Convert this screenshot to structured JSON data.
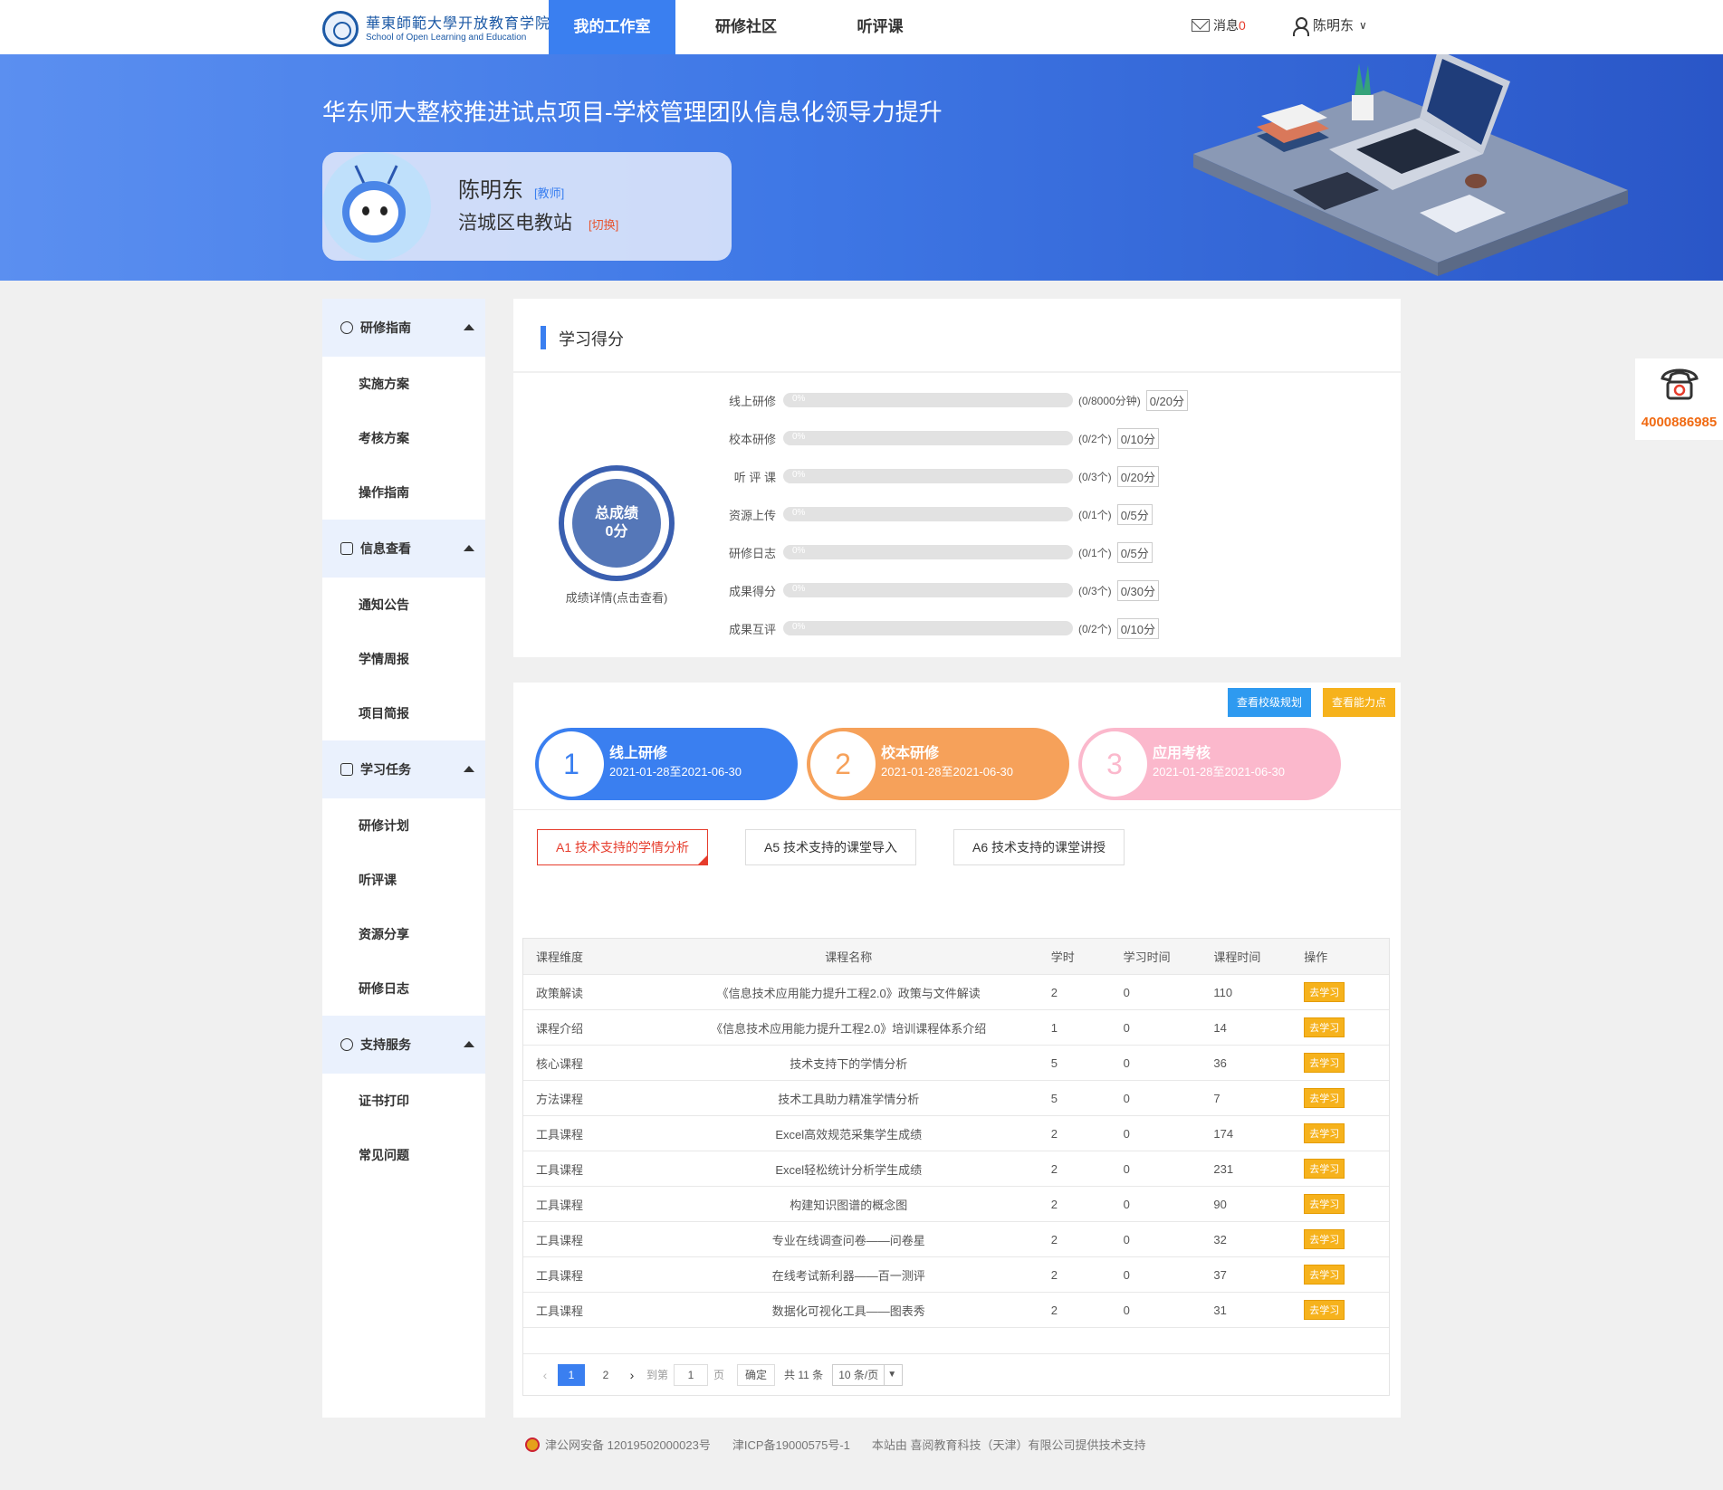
{
  "header": {
    "logo_cn": "華東師範大學开放教育学院",
    "logo_en": "School of Open Learning and Education",
    "nav": [
      {
        "label": "我的工作室",
        "active": true
      },
      {
        "label": "研修社区",
        "active": false
      },
      {
        "label": "听评课",
        "active": false
      }
    ],
    "messages_label": "消息",
    "messages_count": "0",
    "user_name": "陈明东"
  },
  "banner": {
    "title": "华东师大整校推进试点项目-学校管理团队信息化领导力提升",
    "name": "陈明东",
    "role_tag": "[教师]",
    "org": "涪城区电教站",
    "switch_label": "[切换]"
  },
  "sidebar": {
    "groups": [
      {
        "label": "研修指南",
        "items": [
          "实施方案",
          "考核方案",
          "操作指南"
        ]
      },
      {
        "label": "信息查看",
        "items": [
          "通知公告",
          "学情周报",
          "项目简报"
        ]
      },
      {
        "label": "学习任务",
        "items": [
          "研修计划",
          "听评课",
          "资源分享",
          "研修日志"
        ]
      },
      {
        "label": "支持服务",
        "items": [
          "证书打印",
          "常见问题"
        ]
      }
    ]
  },
  "score": {
    "section_title": "学习得分",
    "total_label": "总成绩",
    "total_value": "0分",
    "detail_link": "成绩详情(点击查看)",
    "rows": [
      {
        "label": "线上研修",
        "percent": "0%",
        "count": "(0/8000分钟)",
        "points": "0/20分"
      },
      {
        "label": "校本研修",
        "percent": "0%",
        "count": "(0/2个)",
        "points": "0/10分"
      },
      {
        "label": "听 评 课",
        "percent": "0%",
        "count": "(0/3个)",
        "points": "0/20分"
      },
      {
        "label": "资源上传",
        "percent": "0%",
        "count": "(0/1个)",
        "points": "0/5分"
      },
      {
        "label": "研修日志",
        "percent": "0%",
        "count": "(0/1个)",
        "points": "0/5分"
      },
      {
        "label": "成果得分",
        "percent": "0%",
        "count": "(0/3个)",
        "points": "0/30分"
      },
      {
        "label": "成果互评",
        "percent": "0%",
        "count": "(0/2个)",
        "points": "0/10分"
      }
    ]
  },
  "stages": {
    "btn_plan": "查看校级规划",
    "btn_ability": "查看能力点",
    "items": [
      {
        "num": "1",
        "title": "线上研修",
        "dates": "2021-01-28至2021-06-30"
      },
      {
        "num": "2",
        "title": "校本研修",
        "dates": "2021-01-28至2021-06-30"
      },
      {
        "num": "3",
        "title": "应用考核",
        "dates": "2021-01-28至2021-06-30"
      }
    ],
    "abilities": [
      {
        "label": "A1 技术支持的学情分析",
        "active": true
      },
      {
        "label": "A5 技术支持的课堂导入",
        "active": false
      },
      {
        "label": "A6 技术支持的课堂讲授",
        "active": false
      }
    ]
  },
  "table": {
    "headers": [
      "课程维度",
      "课程名称",
      "学时",
      "学习时间",
      "课程时间",
      "操作"
    ],
    "action_label": "去学习",
    "rows": [
      {
        "dim": "政策解读",
        "name": "《信息技术应用能力提升工程2.0》政策与文件解读",
        "hours": "2",
        "study": "0",
        "course": "110"
      },
      {
        "dim": "课程介绍",
        "name": "《信息技术应用能力提升工程2.0》培训课程体系介绍",
        "hours": "1",
        "study": "0",
        "course": "14"
      },
      {
        "dim": "核心课程",
        "name": "技术支持下的学情分析",
        "hours": "5",
        "study": "0",
        "course": "36"
      },
      {
        "dim": "方法课程",
        "name": "技术工具助力精准学情分析",
        "hours": "5",
        "study": "0",
        "course": "7"
      },
      {
        "dim": "工具课程",
        "name": "Excel高效规范采集学生成绩",
        "hours": "2",
        "study": "0",
        "course": "174"
      },
      {
        "dim": "工具课程",
        "name": "Excel轻松统计分析学生成绩",
        "hours": "2",
        "study": "0",
        "course": "231"
      },
      {
        "dim": "工具课程",
        "name": "构建知识图谱的概念图",
        "hours": "2",
        "study": "0",
        "course": "90"
      },
      {
        "dim": "工具课程",
        "name": "专业在线调查问卷——问卷星",
        "hours": "2",
        "study": "0",
        "course": "32"
      },
      {
        "dim": "工具课程",
        "name": "在线考试新利器——百一测评",
        "hours": "2",
        "study": "0",
        "course": "37"
      },
      {
        "dim": "工具课程",
        "name": "数据化可视化工具——图表秀",
        "hours": "2",
        "study": "0",
        "course": "31"
      }
    ]
  },
  "pager": {
    "pages": [
      "1",
      "2"
    ],
    "goto_label": "到第",
    "goto_value": "1",
    "page_unit": "页",
    "confirm": "确定",
    "total": "共 11 条",
    "size": "10 条/页"
  },
  "phone": {
    "number": "4000886985"
  },
  "footer": {
    "police": "津公网安备 12019502000023号",
    "icp": "津ICP备19000575号-1",
    "support": "本站由 喜阅教育科技（天津）有限公司提供技术支持"
  }
}
